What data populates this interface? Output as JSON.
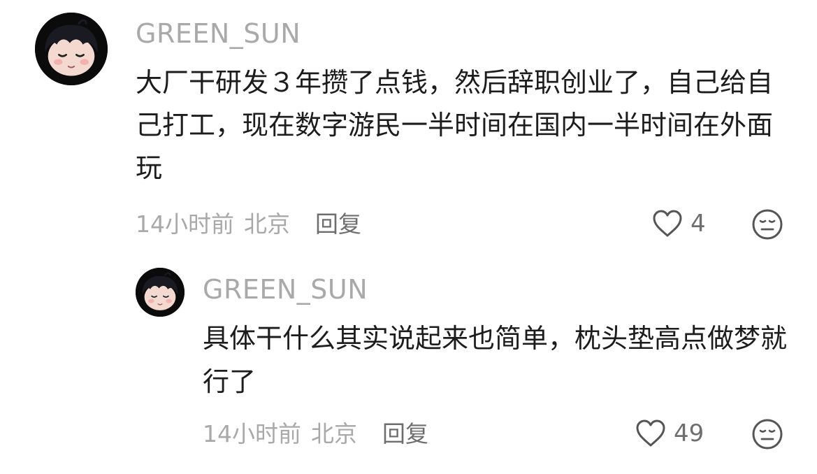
{
  "comments": [
    {
      "username": "GREEN_SUN",
      "text": "大厂干研发３年攒了点钱，然后辞职创业了，自己给自己打工，现在数字游民一半时间在国内一半时间在外面玩",
      "time": "14小时前",
      "location": "北京",
      "reply_label": "回复",
      "like_count": "4",
      "like_icon": "heart-outline",
      "dislike_icon": "meh-face-outline"
    },
    {
      "username": "GREEN_SUN",
      "text": "具体干什么其实说起来也简单，枕头垫高点做梦就行了",
      "time": "14小时前",
      "location": "北京",
      "reply_label": "回复",
      "like_count": "49",
      "like_icon": "heart-outline",
      "dislike_icon": "meh-face-outline"
    }
  ],
  "colors": {
    "username": "#a9a9a9",
    "body_text": "#1c1c1c",
    "meta": "#a9a9a9",
    "action": "#6e6e6e",
    "avatar_bg": "#0b0b0b"
  }
}
